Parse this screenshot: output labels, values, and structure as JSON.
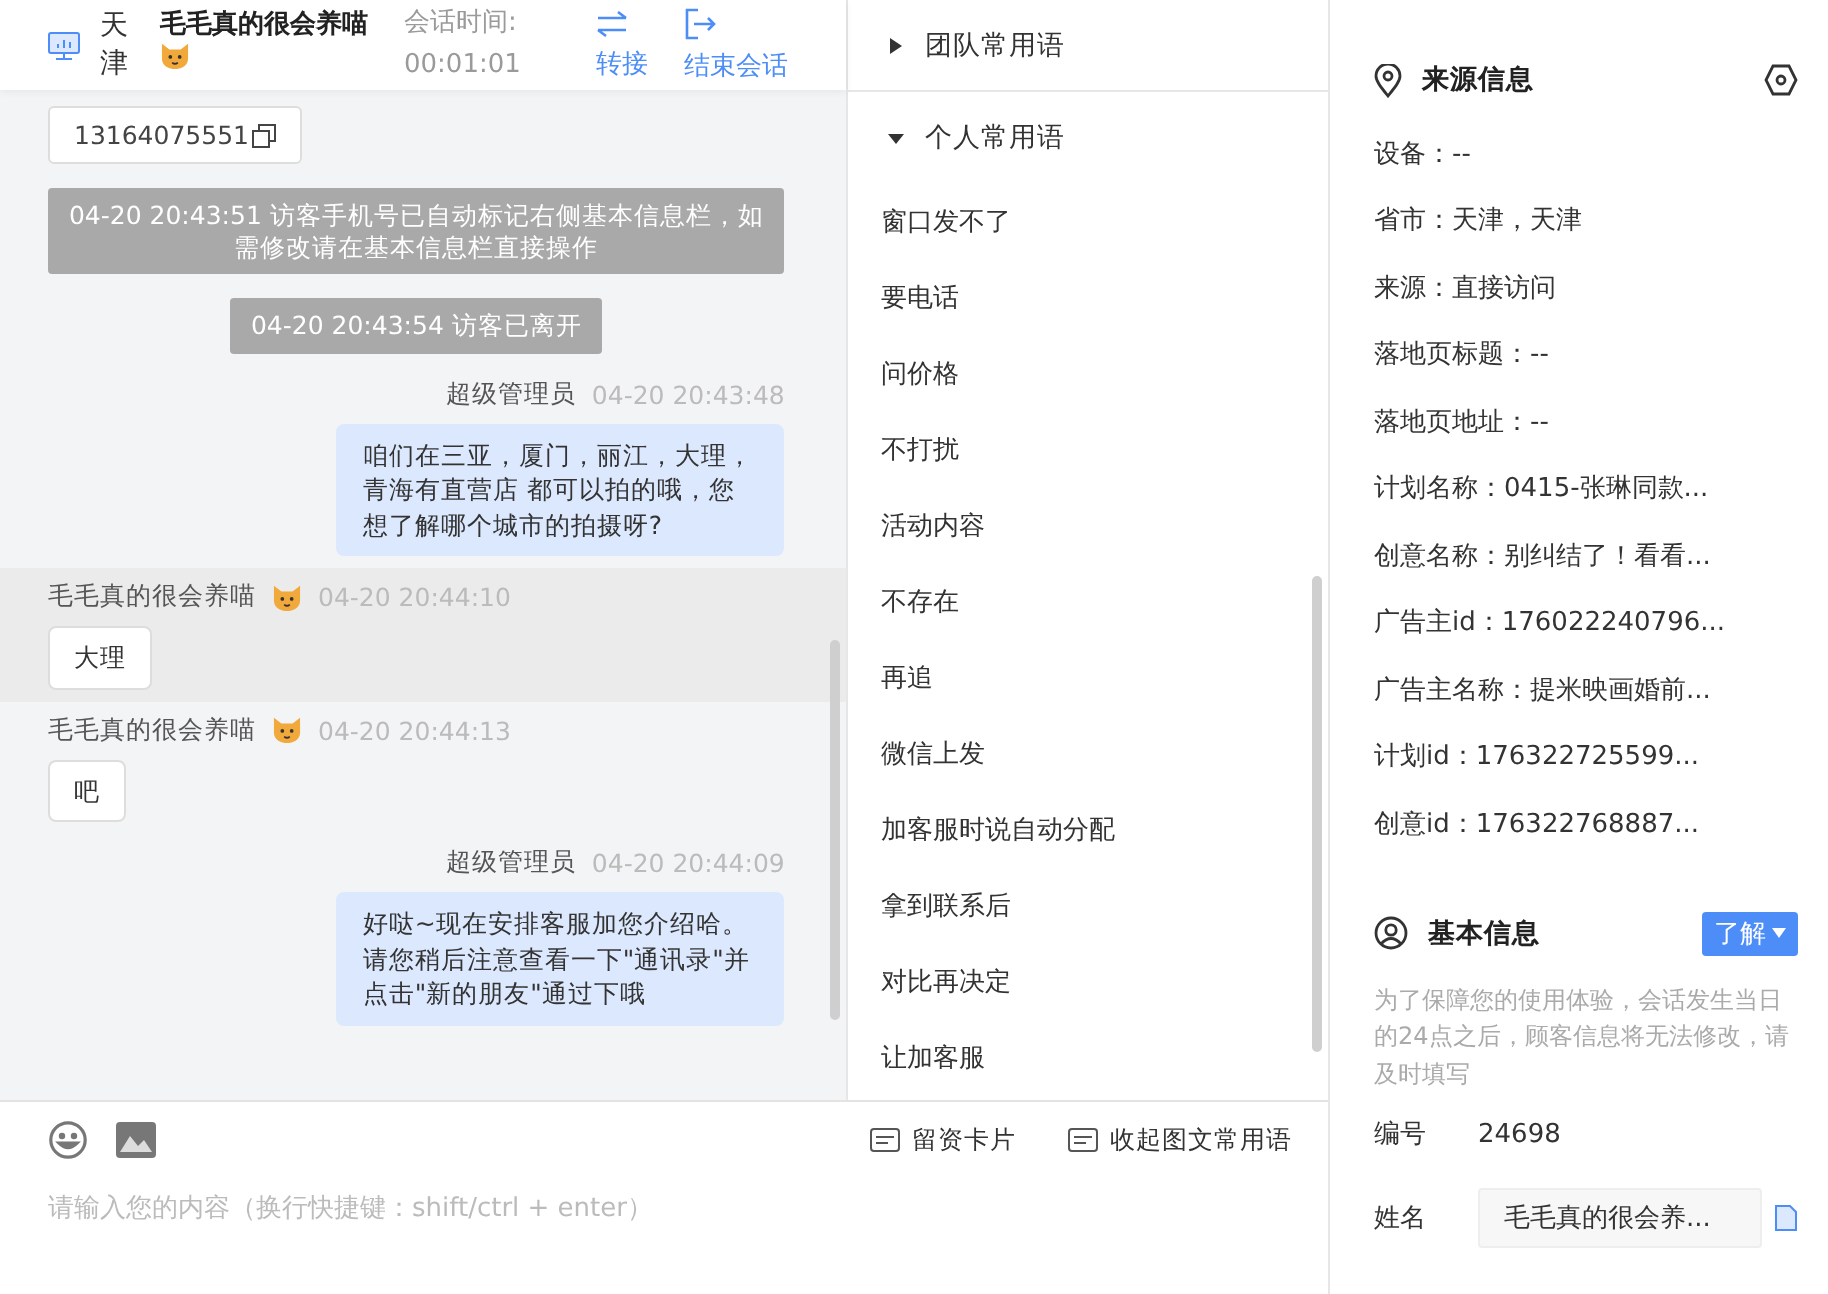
{
  "header": {
    "location": "天津",
    "visitor_name": "毛毛真的很会养喵",
    "session_label": "会话时间:",
    "session_time": "00:01:01",
    "actions": [
      {
        "kind": "transfer",
        "label": "转接"
      },
      {
        "kind": "end",
        "label": "结束会话"
      }
    ]
  },
  "messages": [
    {
      "kind": "phone",
      "text": "13164075551",
      "highlighted": false
    },
    {
      "kind": "notice",
      "text": "04-20 20:43:51 访客手机号已自动标记右侧基本信息栏，如需修改请在基本信息栏直接操作",
      "highlighted": false
    },
    {
      "kind": "notice",
      "text": "04-20 20:43:54 访客已离开",
      "highlighted": false
    },
    {
      "kind": "agent",
      "sender": "超级管理员",
      "time": "04-20 20:43:48",
      "text": "咱们在三亚，厦门，丽江，大理，青海有直营店 都可以拍的哦，您想了解哪个城市的拍摄呀?",
      "highlighted": false
    },
    {
      "kind": "visitor",
      "sender": "毛毛真的很会养喵",
      "time": "04-20 20:44:10",
      "text": "大理",
      "highlighted": true
    },
    {
      "kind": "visitor",
      "sender": "毛毛真的很会养喵",
      "time": "04-20 20:44:13",
      "text": "吧",
      "highlighted": false
    },
    {
      "kind": "agent",
      "sender": "超级管理员",
      "time": "04-20 20:44:09",
      "text": "好哒~现在安排客服加您介绍哈。请您稍后注意查看一下\"通讯录\"并点击\"新的朋友\"通过下哦",
      "highlighted": false
    }
  ],
  "phrases": [
    {
      "title": "团队常用语",
      "expanded": false
    },
    {
      "title": "个人常用语",
      "expanded": true,
      "items": [
        "窗口发不了",
        "要电话",
        "问价格",
        "不打扰",
        "活动内容",
        "不存在",
        "再追",
        "微信上发",
        "加客服时说自动分配",
        "拿到联系后",
        "对比再决定",
        "让加客服"
      ]
    }
  ],
  "composer": {
    "tools": [
      {
        "kind": "emoji"
      },
      {
        "kind": "image"
      }
    ],
    "buttons": [
      {
        "label": "留资卡片"
      },
      {
        "label": "收起图文常用语"
      }
    ],
    "placeholder": "请输入您的内容（换行快捷键：shift/ctrl + enter）"
  },
  "source_info": {
    "title": "来源信息",
    "fields": [
      "设备：--",
      "省市：天津，天津",
      "来源：直接访问",
      "落地页标题：--",
      "落地页地址：--",
      "计划名称：0415-张琳同款...",
      "创意名称：别纠结了！看看...",
      "广告主id：176022240796...",
      "广告主名称：提米映画婚前...",
      "计划id：176322725599...",
      "创意id：176322768887..."
    ]
  },
  "basic_info": {
    "title": "基本信息",
    "learn_button": "了解",
    "notice": "为了保障您的使用体验，会话发生当日的24点之后，顾客信息将无法修改，请及时填写",
    "fields": [
      {
        "kind": "text",
        "label": "编号",
        "value": "24698"
      },
      {
        "kind": "input",
        "label": "姓名",
        "value": "毛毛真的很会养..."
      }
    ]
  }
}
